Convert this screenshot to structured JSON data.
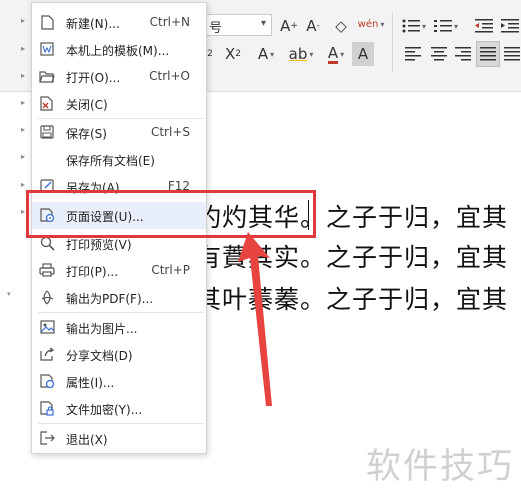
{
  "toolbar": {
    "font_size": "号",
    "grow_font": "A",
    "shrink_font": "A",
    "clear_format": "◇",
    "phonetic": "wén",
    "superscript": "X",
    "subscript": "X",
    "text_effect": "A",
    "highlight": "ab",
    "font_color": "A",
    "char_shading": "A"
  },
  "menu": {
    "items": [
      {
        "label": "新建(N)...",
        "shortcut": "Ctrl+N"
      },
      {
        "label": "本机上的模板(M)...",
        "shortcut": ""
      },
      {
        "label": "打开(O)...",
        "shortcut": "Ctrl+O"
      },
      {
        "label": "关闭(C)",
        "shortcut": ""
      },
      {
        "label": "保存(S)",
        "shortcut": "Ctrl+S"
      },
      {
        "label": "保存所有文档(E)",
        "shortcut": ""
      },
      {
        "label": "另存为(A)...",
        "shortcut": "F12"
      },
      {
        "label": "页面设置(U)...",
        "shortcut": ""
      },
      {
        "label": "打印预览(V)",
        "shortcut": ""
      },
      {
        "label": "打印(P)...",
        "shortcut": "Ctrl+P"
      },
      {
        "label": "输出为PDF(F)...",
        "shortcut": ""
      },
      {
        "label": "输出为图片...",
        "shortcut": ""
      },
      {
        "label": "分享文档(D)",
        "shortcut": ""
      },
      {
        "label": "属性(I)...",
        "shortcut": ""
      },
      {
        "label": "文件加密(Y)...",
        "shortcut": ""
      },
      {
        "label": "退出(X)",
        "shortcut": ""
      }
    ]
  },
  "document": {
    "line1": "灼灼其华。之子于归，宜其",
    "line2": "有蕡其实。之子于归，宜其",
    "line3": "其叶蓁蓁。之子于归，宜其"
  },
  "watermark": "软件技巧",
  "colors": {
    "highlight_box": "#e0383c",
    "menu_hover": "#e8eefa"
  }
}
